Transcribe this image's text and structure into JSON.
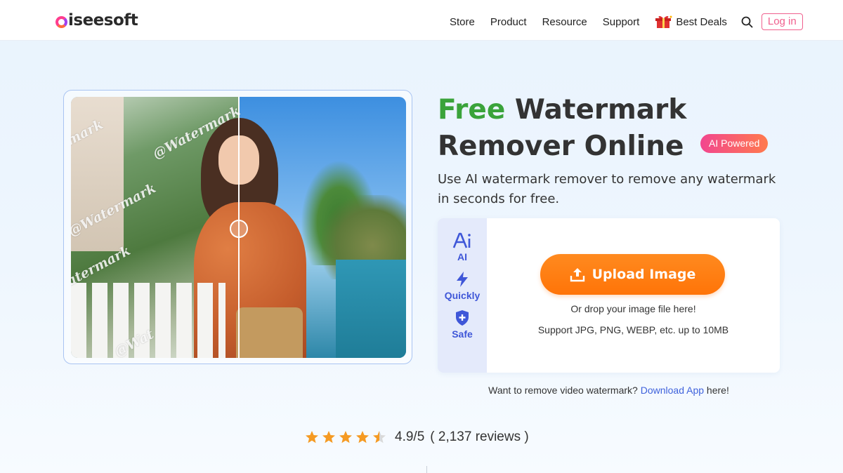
{
  "header": {
    "logo": "aiseesoft",
    "nav": [
      "Store",
      "Product",
      "Resource",
      "Support"
    ],
    "deals_label": "Best Deals",
    "login_label": "Log in"
  },
  "hero": {
    "watermark_text": "@Watermark",
    "watermark_fragments": [
      "mark",
      "@Watermark",
      "@Watermark",
      "atermark",
      "@Wat"
    ]
  },
  "title": {
    "free": "Free",
    "line1_rest": "Watermark",
    "line2": "Remover Online",
    "badge": "AI Powered"
  },
  "subtitle": "Use AI watermark remover to remove any watermark in seconds for free.",
  "upload": {
    "features": [
      {
        "icon": "ai-icon",
        "label": "AI"
      },
      {
        "icon": "lightning-icon",
        "label": "Quickly"
      },
      {
        "icon": "shield-plus-icon",
        "label": "Safe"
      }
    ],
    "button_label": "Upload Image",
    "drop_text": "Or drop your image file here!",
    "support_text": "Support JPG, PNG, WEBP, etc. up to 10MB"
  },
  "video_line": {
    "prefix": "Want to remove video watermark?",
    "link": "Download App",
    "suffix": "here!"
  },
  "rating": {
    "stars": 4.5,
    "score": "4.9/5",
    "reviews": "( 2,137 reviews )"
  },
  "colors": {
    "accent_green": "#3aa33a",
    "button_orange": "#ff7c12",
    "link_blue": "#3f62dc",
    "login_pink": "#f0608e",
    "star_orange": "#f59a23"
  }
}
